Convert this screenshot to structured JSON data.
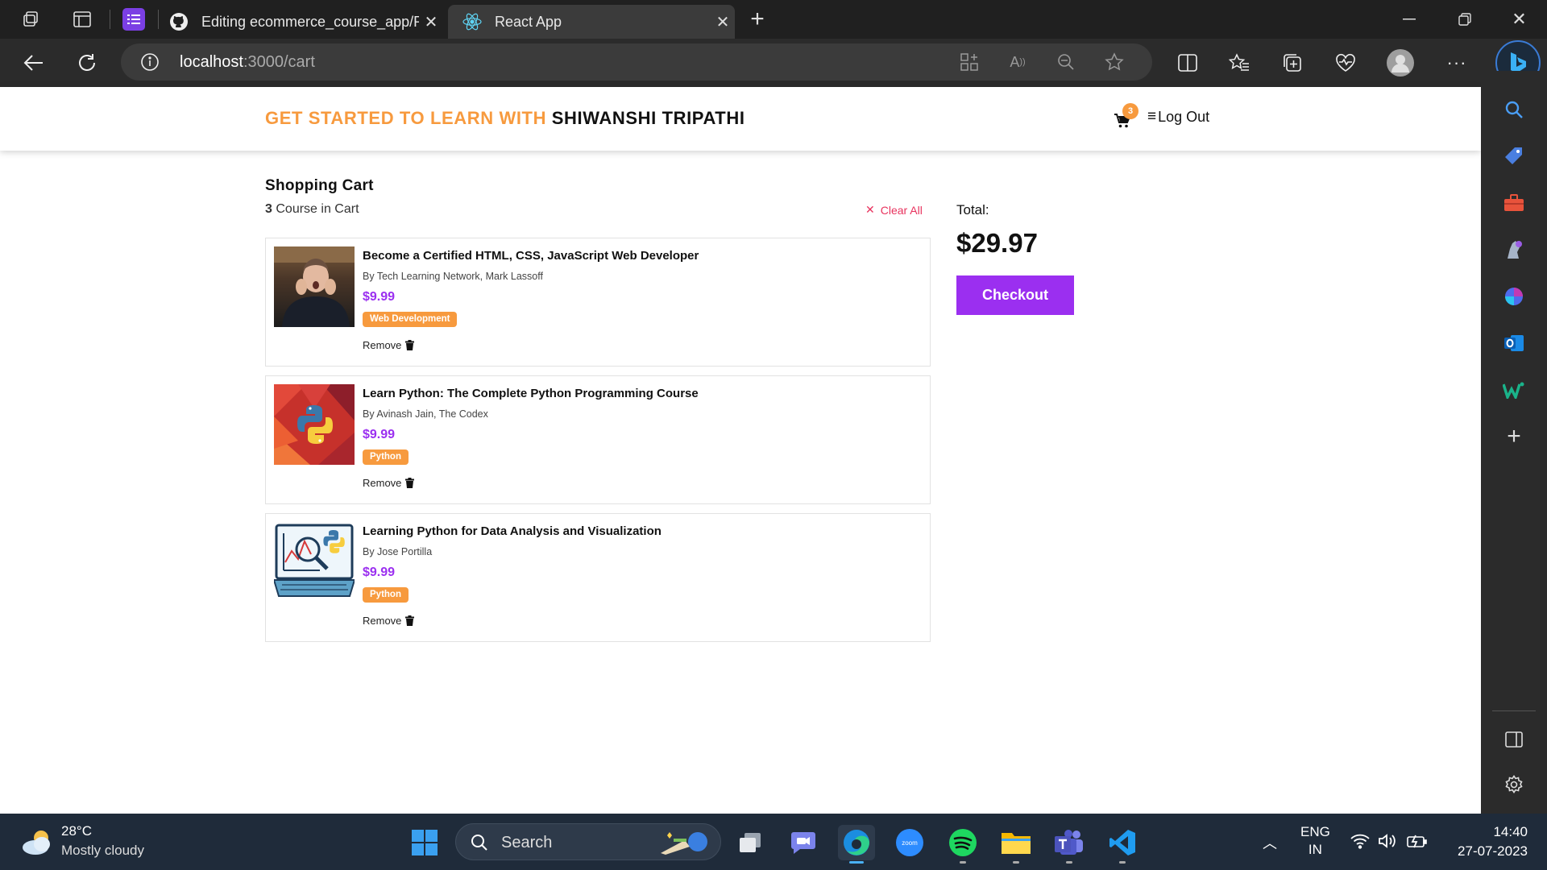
{
  "browser": {
    "tabs": [
      {
        "title": "Editing ecommerce_course_app/README.md",
        "icon": "github-icon",
        "active": false
      },
      {
        "title": "React App",
        "icon": "react-icon",
        "active": true
      }
    ],
    "url_host": "localhost",
    "url_path": ":3000/cart"
  },
  "site": {
    "brand_prefix": "GET STARTED TO LEARN WITH",
    "brand_name": "SHIWANSHI TRIPATHI",
    "cart_count": "3",
    "logout_label": "Log Out",
    "accent_orange": "#f79a3e",
    "accent_purple": "#9b2ff0"
  },
  "cart": {
    "heading": "Shopping Cart",
    "count": "3",
    "count_suffix": "Course in Cart",
    "clear_label": "Clear All",
    "items": [
      {
        "title": "Become a Certified HTML, CSS, JavaScript Web Developer",
        "author": "By Tech Learning Network, Mark Lassoff",
        "price": "$9.99",
        "tag": "Web Development",
        "remove": "Remove"
      },
      {
        "title": "Learn Python: The Complete Python Programming Course",
        "author": "By Avinash Jain, The Codex",
        "price": "$9.99",
        "tag": "Python",
        "remove": "Remove"
      },
      {
        "title": "Learning Python for Data Analysis and Visualization",
        "author": "By Jose Portilla",
        "price": "$9.99",
        "tag": "Python",
        "remove": "Remove"
      }
    ]
  },
  "summary": {
    "total_label": "Total:",
    "total_value": "$29.97",
    "checkout_label": "Checkout"
  },
  "taskbar": {
    "temp": "28°C",
    "weather": "Mostly cloudy",
    "search_label": "Search",
    "lang_top": "ENG",
    "lang_bottom": "IN",
    "time": "14:40",
    "date": "27-07-2023"
  }
}
